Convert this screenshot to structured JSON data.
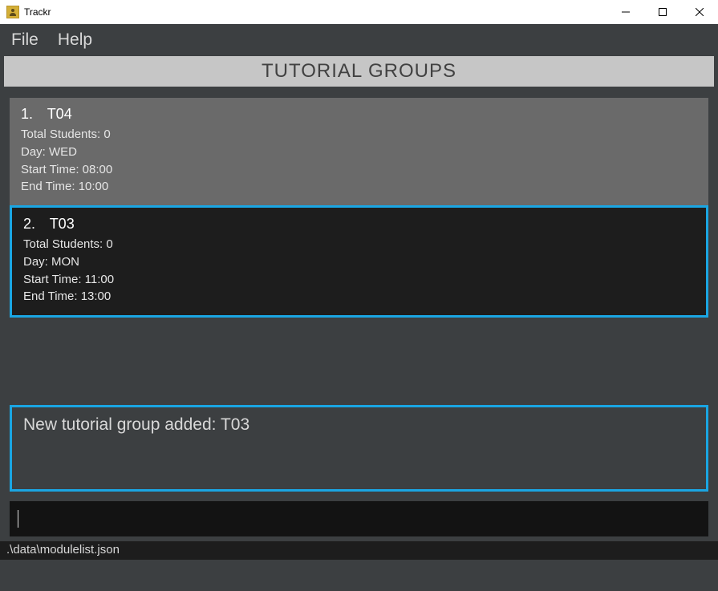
{
  "window": {
    "title": "Trackr"
  },
  "menubar": {
    "file": "File",
    "help": "Help"
  },
  "section": {
    "header": "TUTORIAL GROUPS"
  },
  "groups": [
    {
      "index": "1.",
      "name": "T04",
      "students_label": "Total Students: 0",
      "day_label": "Day: WED",
      "start_label": "Start Time: 08:00",
      "end_label": "End Time: 10:00"
    },
    {
      "index": "2.",
      "name": "T03",
      "students_label": "Total Students: 0",
      "day_label": "Day: MON",
      "start_label": "Start Time: 11:00",
      "end_label": "End Time: 13:00"
    }
  ],
  "message": {
    "text": "New tutorial group added: T03"
  },
  "command": {
    "value": ""
  },
  "statusbar": {
    "path": ".\\data\\modulelist.json"
  }
}
